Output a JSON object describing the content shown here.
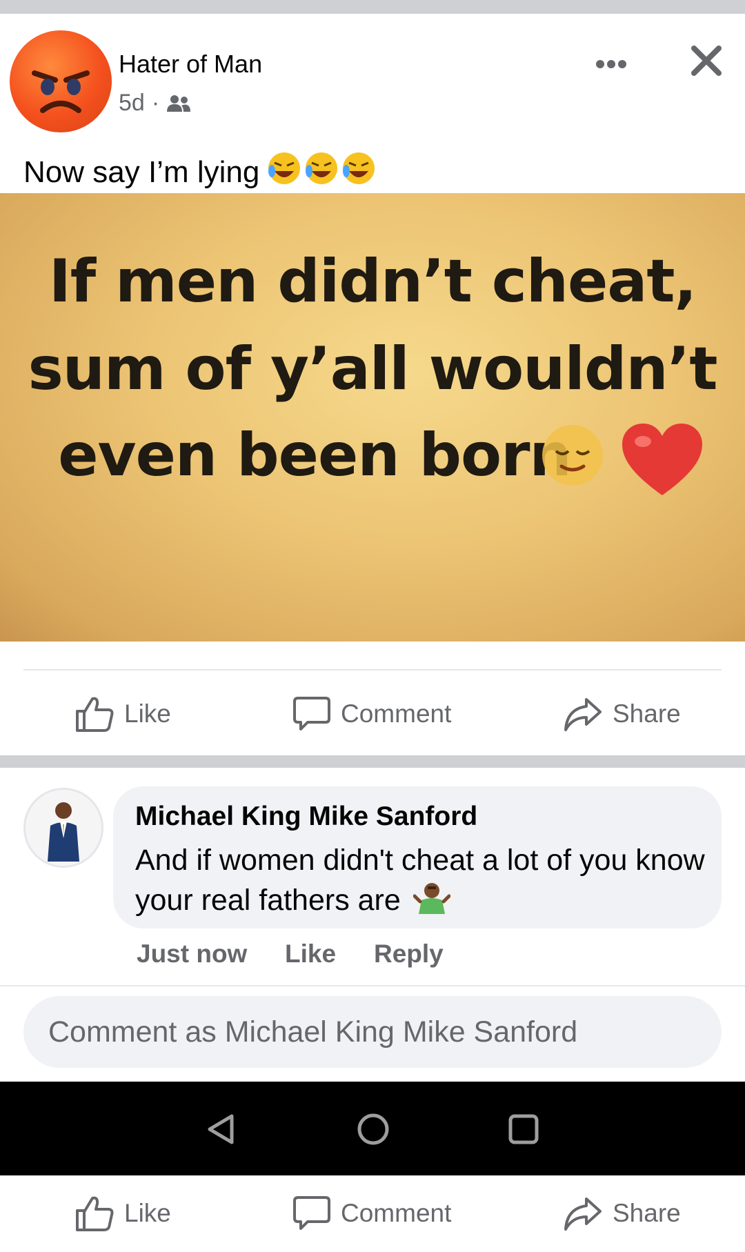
{
  "post": {
    "author": "Hater of Man",
    "time": "5d",
    "dot": "·",
    "caption": "Now say I’m lying",
    "meme_lines": [
      "If men didn’t cheat,",
      "sum of y’all wouldn’t",
      "even been born"
    ]
  },
  "actions": {
    "like": "Like",
    "comment": "Comment",
    "share": "Share"
  },
  "comment": {
    "author": "Michael King Mike Sanford",
    "text": "And if women didn't cheat a lot of you know your real fathers are",
    "time": "Just now",
    "like": "Like",
    "reply": "Reply"
  },
  "composer": {
    "placeholder": "Comment as Michael King Mike Sanford"
  },
  "icons": [
    "angry-face-icon",
    "friends-icon",
    "more-icon",
    "close-icon",
    "laughing-emoji-icon",
    "relieved-emoji-icon",
    "heart-icon",
    "like-icon",
    "comment-icon",
    "share-icon",
    "shrug-emoji-icon",
    "back-nav-icon",
    "home-nav-icon",
    "recents-nav-icon"
  ],
  "colors": {
    "secondary_text": "#65676b",
    "bubble": "#f0f2f5",
    "divider": "#ced0d4",
    "angry_orange": "#f4511e"
  }
}
